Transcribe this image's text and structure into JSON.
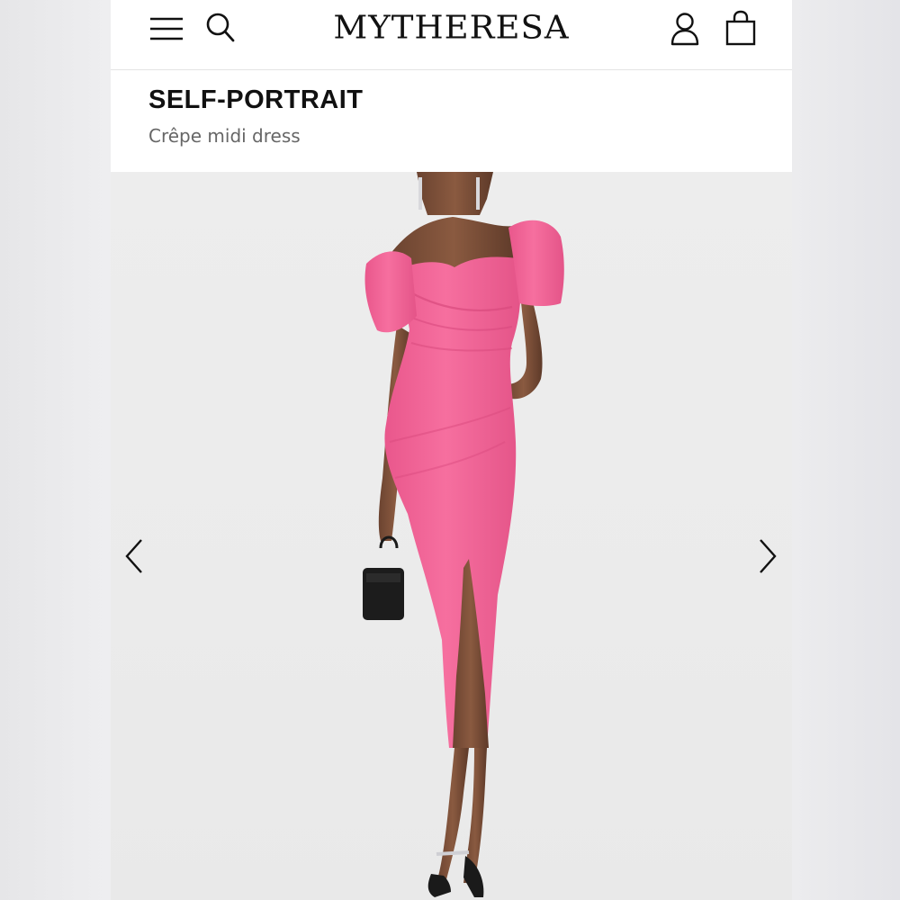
{
  "header": {
    "logo": "MYTHERESA",
    "icons": {
      "menu": "hamburger-menu-icon",
      "search": "search-icon",
      "account": "user-icon",
      "bag": "shopping-bag-icon"
    }
  },
  "product": {
    "brand": "SELF-PORTRAIT",
    "name": "Crêpe midi dress"
  },
  "gallery": {
    "prev_icon": "chevron-left-icon",
    "next_icon": "chevron-right-icon",
    "dress_color": "#f2699a"
  },
  "colors": {
    "text": "#111111",
    "muted": "#666666",
    "background": "#ffffff",
    "photo_bg": "#ebebeb"
  }
}
